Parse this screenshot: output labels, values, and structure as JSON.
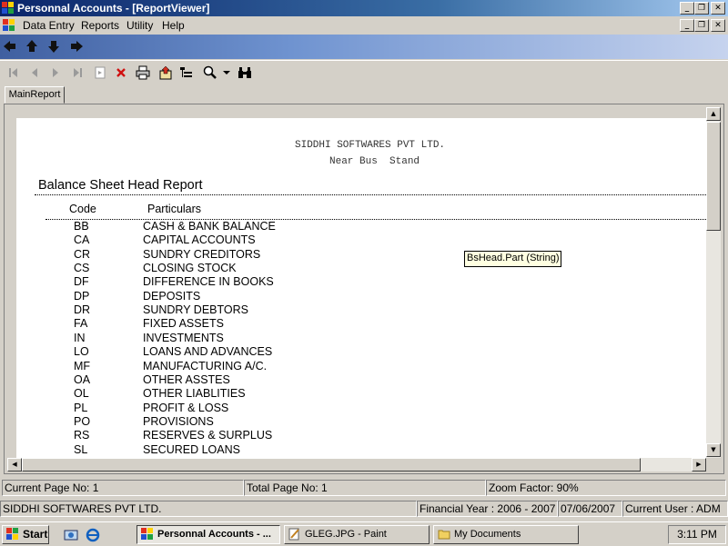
{
  "window": {
    "title": "Personnal Accounts - [ReportViewer]"
  },
  "menu": {
    "items": [
      "Data Entry",
      "Reports",
      "Utility",
      "Help"
    ]
  },
  "tab": {
    "label": "MainReport"
  },
  "report": {
    "company": "SIDDHI SOFTWARES PVT LTD.",
    "address": "Near Bus  Stand",
    "title": "Balance Sheet Head Report",
    "col_code": "Code",
    "col_particulars": "Particulars",
    "rows": [
      {
        "code": "BB",
        "part": "CASH & BANK BALANCE"
      },
      {
        "code": "CA",
        "part": "CAPITAL ACCOUNTS"
      },
      {
        "code": "CR",
        "part": "SUNDRY CREDITORS"
      },
      {
        "code": "CS",
        "part": "CLOSING STOCK"
      },
      {
        "code": "DF",
        "part": "DIFFERENCE IN BOOKS"
      },
      {
        "code": "DP",
        "part": "DEPOSITS"
      },
      {
        "code": "DR",
        "part": "SUNDRY DEBTORS"
      },
      {
        "code": "FA",
        "part": "FIXED ASSETS"
      },
      {
        "code": "IN",
        "part": "INVESTMENTS"
      },
      {
        "code": "LO",
        "part": "LOANS AND ADVANCES"
      },
      {
        "code": "MF",
        "part": "MANUFACTURING A/C."
      },
      {
        "code": "OA",
        "part": "OTHER ASSTES"
      },
      {
        "code": "OL",
        "part": "OTHER LIABLITIES"
      },
      {
        "code": "PL",
        "part": "PROFIT & LOSS"
      },
      {
        "code": "PO",
        "part": "PROVISIONS"
      },
      {
        "code": "RS",
        "part": "RESERVES & SURPLUS"
      },
      {
        "code": "SL",
        "part": "SECURED LOANS"
      }
    ],
    "tooltip": "BsHead.Part (String)"
  },
  "viewer_status": {
    "current_page": "Current Page No: 1",
    "total_page": "Total Page No: 1",
    "zoom": "Zoom Factor: 90%"
  },
  "app_status": {
    "company": "SIDDHI SOFTWARES PVT LTD.",
    "financial_year": "Financial Year : 2006 - 2007",
    "date": "07/06/2007",
    "user": "Current User : ADM"
  },
  "taskbar": {
    "start": "Start",
    "tasks": [
      "Personnal Accounts - ...",
      "GLEG.JPG - Paint",
      "My Documents"
    ],
    "clock": "3:11 PM"
  },
  "colors": {
    "titlebar": "#0a246a",
    "navbar": "#3f5fa0",
    "face": "#d4d0c8"
  }
}
